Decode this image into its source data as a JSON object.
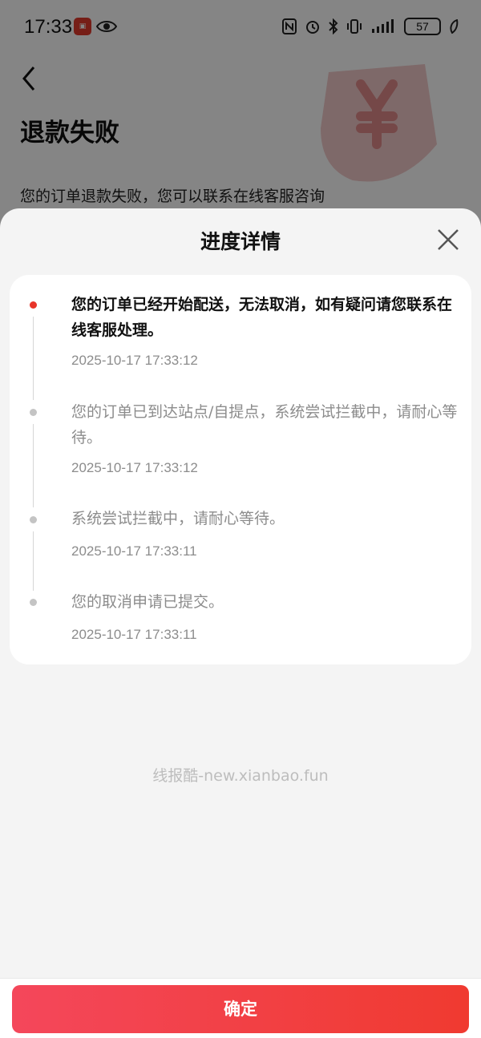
{
  "status_bar": {
    "time": "17:33",
    "battery": "57"
  },
  "background_page": {
    "title": "退款失败",
    "description": "您的订单退款失败，您可以联系在线客服咨询"
  },
  "sheet": {
    "title": "进度详情",
    "timeline": [
      {
        "text": "您的订单已经开始配送，无法取消，如有疑问请您联系在线客服处理。",
        "time": "2025-10-17 17:33:12",
        "active": true
      },
      {
        "text": "您的订单已到达站点/自提点，系统尝试拦截中，请耐心等待。",
        "time": "2025-10-17 17:33:12",
        "active": false
      },
      {
        "text": "系统尝试拦截中，请耐心等待。",
        "time": "2025-10-17 17:33:11",
        "active": false
      },
      {
        "text": "您的取消申请已提交。",
        "time": "2025-10-17 17:33:11",
        "active": false
      }
    ],
    "watermark": "线报酷-new.xianbao.fun"
  },
  "footer": {
    "confirm_label": "确定"
  },
  "colors": {
    "accent": "#e8352a",
    "button_gradient_start": "#f4475b",
    "button_gradient_end": "#f03a30"
  }
}
